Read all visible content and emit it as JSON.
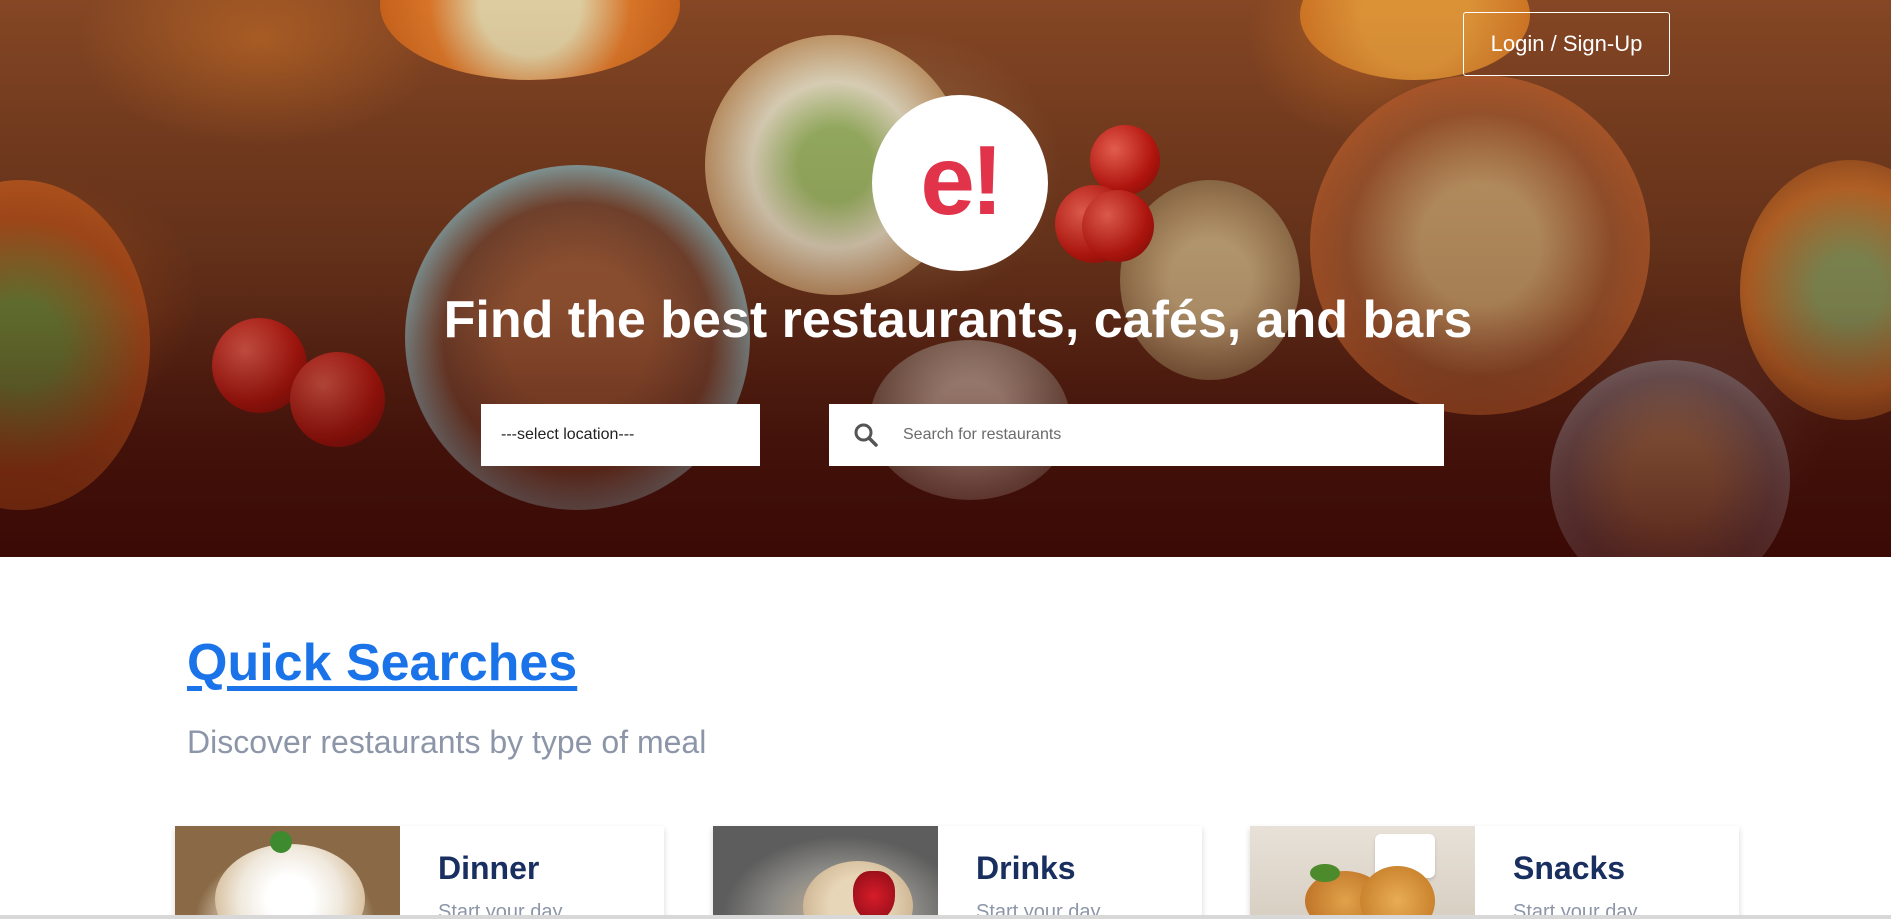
{
  "header": {
    "login_label": "Login / Sign-Up"
  },
  "brand": {
    "logo_text": "e!",
    "logo_color": "#e1334a"
  },
  "hero": {
    "title": "Find the best restaurants, cafés, and bars",
    "location_select": {
      "selected": "---select location---",
      "options": [
        "---select location---"
      ]
    },
    "search": {
      "placeholder": "Search for restaurants",
      "value": "",
      "icon": "search-icon"
    }
  },
  "quick_searches": {
    "title": "Quick Searches",
    "subtitle": "Discover restaurants by type of meal",
    "cards": [
      {
        "title": "Dinner",
        "description": "Start your day"
      },
      {
        "title": "Drinks",
        "description": "Start your day"
      },
      {
        "title": "Snacks",
        "description": "Start your day"
      }
    ]
  },
  "colors": {
    "link_blue": "#1a73e8",
    "card_title": "#192f60",
    "muted_text": "#8c96a8"
  }
}
